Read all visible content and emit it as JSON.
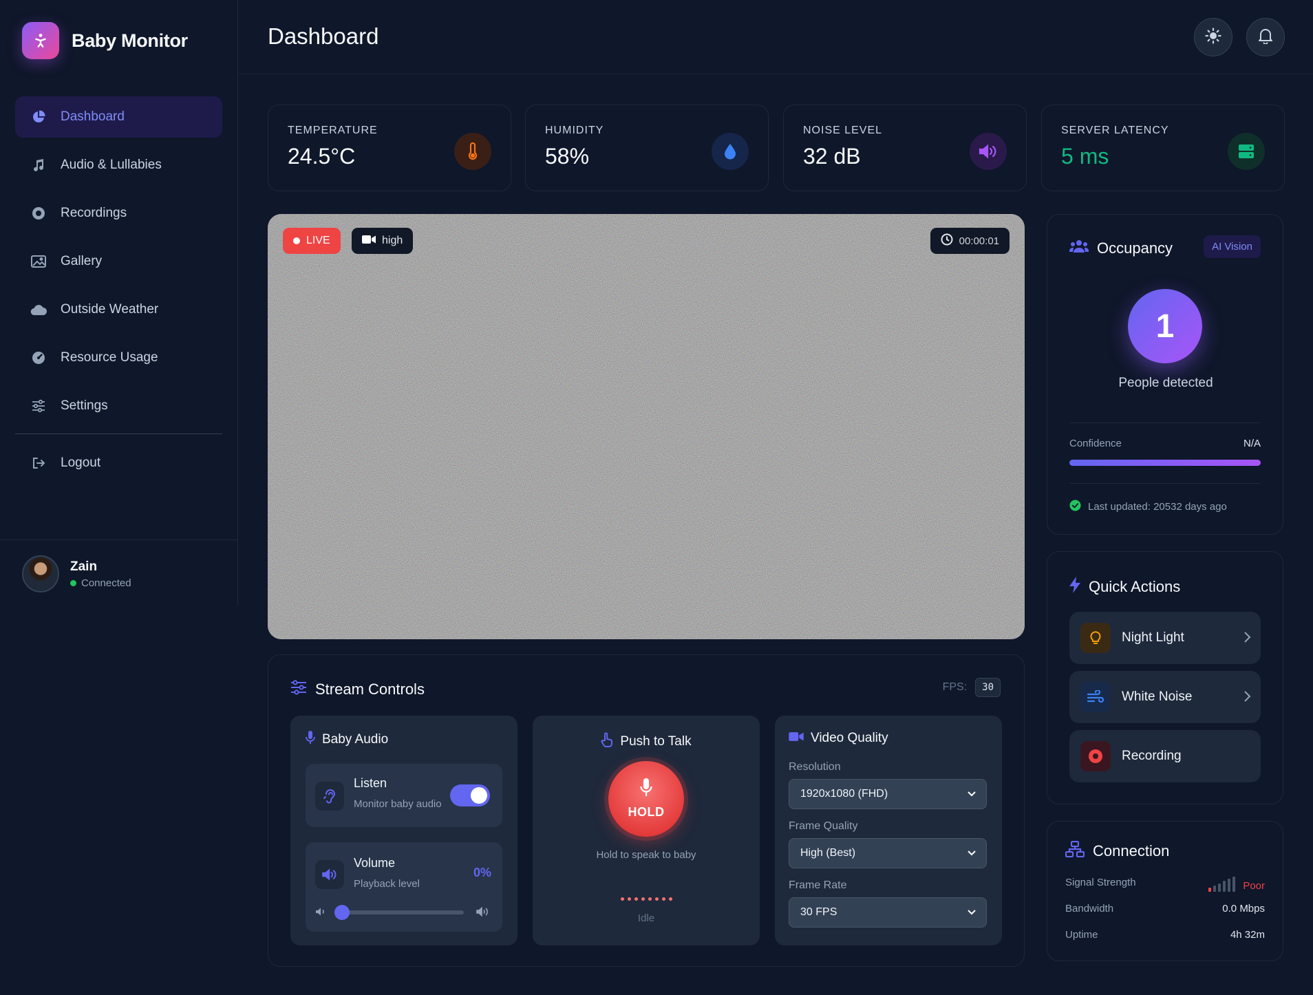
{
  "app": {
    "title": "Baby Monitor"
  },
  "sidebar": {
    "items": [
      {
        "label": "Dashboard",
        "icon": "pie-chart-icon",
        "active": true
      },
      {
        "label": "Audio & Lullabies",
        "icon": "music-note-icon"
      },
      {
        "label": "Recordings",
        "icon": "record-icon"
      },
      {
        "label": "Gallery",
        "icon": "image-icon"
      },
      {
        "label": "Outside Weather",
        "icon": "cloud-icon"
      },
      {
        "label": "Resource Usage",
        "icon": "gauge-icon"
      },
      {
        "label": "Settings",
        "icon": "sliders-icon"
      }
    ],
    "logout_label": "Logout",
    "user": {
      "name": "Zain",
      "status": "Connected"
    }
  },
  "header": {
    "title": "Dashboard"
  },
  "stats": [
    {
      "label": "TEMPERATURE",
      "value": "24.5°C",
      "icon": "thermometer-icon",
      "color": "#f97316"
    },
    {
      "label": "HUMIDITY",
      "value": "58%",
      "icon": "droplet-icon",
      "color": "#3b82f6"
    },
    {
      "label": "NOISE LEVEL",
      "value": "32 dB",
      "icon": "volume-icon",
      "color": "#a855f7"
    },
    {
      "label": "SERVER LATENCY",
      "value": "5 ms",
      "icon": "server-icon",
      "color": "#10b981"
    }
  ],
  "video": {
    "live_label": "LIVE",
    "quality_label": "high",
    "timer": "00:00:01"
  },
  "stream_controls": {
    "title": "Stream Controls",
    "fps_label": "FPS:",
    "fps_value": "30",
    "baby_audio": {
      "title": "Baby Audio",
      "listen_label": "Listen",
      "listen_sub": "Monitor baby audio",
      "listen_on": true,
      "volume_label": "Volume",
      "volume_sub": "Playback level",
      "volume_value": "0%"
    },
    "push_to_talk": {
      "title": "Push to Talk",
      "button_label": "HOLD",
      "hint": "Hold to speak to baby",
      "state": "Idle"
    },
    "video_quality": {
      "title": "Video Quality",
      "resolution_label": "Resolution",
      "resolution_value": "1920x1080 (FHD)",
      "frame_quality_label": "Frame Quality",
      "frame_quality_value": "High (Best)",
      "frame_rate_label": "Frame Rate",
      "frame_rate_value": "30 FPS"
    }
  },
  "occupancy": {
    "title": "Occupancy",
    "badge": "AI Vision",
    "count": "1",
    "caption": "People detected",
    "confidence_label": "Confidence",
    "confidence_value": "N/A",
    "last_updated": "Last updated: 20532 days ago"
  },
  "quick_actions": {
    "title": "Quick Actions",
    "items": [
      {
        "label": "Night Light",
        "icon": "lightbulb-icon"
      },
      {
        "label": "White Noise",
        "icon": "wind-icon"
      },
      {
        "label": "Recording",
        "icon": "record-icon"
      }
    ]
  },
  "connection": {
    "title": "Connection",
    "signal_label": "Signal Strength",
    "signal_value": "Poor",
    "bandwidth_label": "Bandwidth",
    "bandwidth_value": "0.0 Mbps",
    "uptime_label": "Uptime",
    "uptime_value": "4h 32m"
  }
}
